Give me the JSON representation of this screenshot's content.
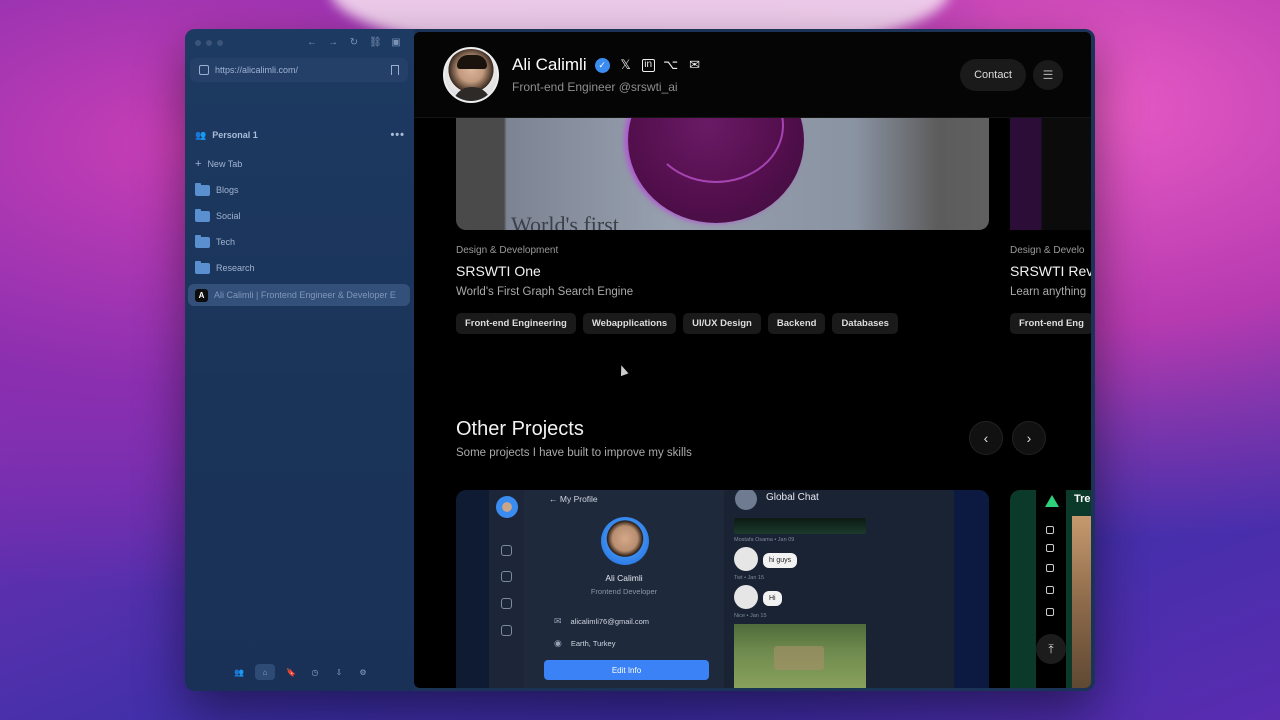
{
  "browser": {
    "url": "https://alicalimli.com/",
    "space_name": "Personal 1",
    "new_tab_label": "New Tab",
    "folders": [
      "Blogs",
      "Social",
      "Tech",
      "Research"
    ],
    "active_tab": "Ali Calimli | Frontend Engineer & Developer E",
    "active_tab_favicon": "A"
  },
  "header": {
    "name": "Ali Calimli",
    "subtitle": "Front-end Engineer @srswti_ai",
    "contact_label": "Contact",
    "social_icons": [
      "x-icon",
      "linkedin-icon",
      "github-icon",
      "mail-icon"
    ]
  },
  "featured": [
    {
      "category": "Design & Development",
      "title": "SRSWTI One",
      "description": "World's First Graph Search Engine",
      "image_text": "World's first",
      "tags": [
        "Front-end Engineering",
        "Webapplications",
        "UI/UX Design",
        "Backend",
        "Databases"
      ]
    },
    {
      "category": "Design & Develo",
      "title": "SRSWTI Rev",
      "description": "Learn anything",
      "tags": [
        "Front-end Eng"
      ]
    }
  ],
  "other_projects": {
    "title": "Other Projects",
    "subtitle": "Some projects I have built to improve my skills"
  },
  "preview": {
    "back_label": "My Profile",
    "name": "Ali Calimli",
    "role": "Frontend Developer",
    "email": "alicalimli76@gmail.com",
    "location": "Earth, Turkey",
    "edit_label": "Edit Info",
    "chat_title": "Global Chat",
    "chat_meta_1": "Mostafa Osama • Jan 09",
    "chat_msg_1": "hi guys",
    "chat_meta_2": "Twt • Jan 15",
    "chat_msg_2": "Hi",
    "chat_meta_3": "Nice • Jan 15",
    "preview2_title": "Tre"
  }
}
